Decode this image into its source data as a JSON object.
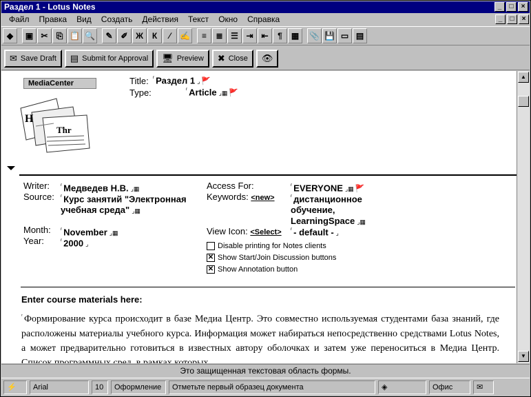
{
  "window": {
    "title": "Раздел 1 - Lotus Notes"
  },
  "menu": [
    "Файл",
    "Правка",
    "Вид",
    "Создать",
    "Действия",
    "Текст",
    "Окно",
    "Справка"
  ],
  "toolbar_icons": [
    "diamond-icon",
    "print-icon",
    "cut-icon",
    "copy-icon",
    "paste-icon",
    "preview-icon",
    "edit-icon",
    "pen-icon",
    "bold-icon",
    "italic-icon",
    "highlighter-icon",
    "paint-icon",
    "align-left-icon",
    "align-center-icon",
    "bullets-icon",
    "indent-icon",
    "outdent-icon",
    "paragraph-icon",
    "table-icon",
    "attach-icon",
    "save-icon",
    "panel-icon",
    "properties-icon"
  ],
  "toolbar_glyphs": [
    "◆",
    "▣",
    "✂",
    "⎘",
    "📋",
    "🔍",
    "✎",
    "✐",
    "Ж",
    "К",
    "⁄",
    "✍",
    "≡",
    "≣",
    "☰",
    "⇥",
    "⇤",
    "¶",
    "▦",
    "📎",
    "💾",
    "▭",
    "▤"
  ],
  "actions": [
    {
      "label": "Save Draft",
      "icon": "✉"
    },
    {
      "label": "Submit for Approval",
      "icon": "▤"
    },
    {
      "label": "Preview",
      "icon": "🖥"
    },
    {
      "label": "Close",
      "icon": "✖"
    },
    {
      "label": "",
      "icon": "👁"
    }
  ],
  "logo": {
    "label": "MediaCenter"
  },
  "header": {
    "title_label": "Title:",
    "title_value": "Раздел 1",
    "type_label": "Type:",
    "type_value": "Article"
  },
  "fields": {
    "writer_label": "Writer:",
    "writer_value": "Медведев Н.В.",
    "source_label": "Source:",
    "source_value": "Курс занятий \"Электронная учебная среда\"",
    "month_label": "Month:",
    "month_value": "November",
    "year_label": "Year:",
    "year_value": "2000",
    "access_label": "Access For:",
    "access_value": "EVERYONE",
    "keywords_label": "Keywords:",
    "keywords_link": "<new>",
    "keywords_value": "дистанционное обучение, LearningSpace",
    "viewicon_label": "View Icon:",
    "viewicon_link": "<Select>",
    "viewicon_value": "- default -"
  },
  "options": [
    {
      "label": "Disable printing for Notes clients",
      "checked": false
    },
    {
      "label": "Show Start/Join Discussion buttons",
      "checked": true
    },
    {
      "label": "Show Annotation button",
      "checked": true
    }
  ],
  "content": {
    "section_title": "Enter course materials here:",
    "body": "Формирование курса происходит в базе Медиа Центр. Это совместно используемая студентами база знаний, где расположены материалы учебного курса. Информация может набираться непосредственно средствами Lotus Notes, а может предварительно готовиться в известных автору оболочках и затем уже переноситься в Медиа Центр. Список программных сред, в рамках которых"
  },
  "status": {
    "message": "Это защищенная текстовая область формы.",
    "font": "Arial",
    "size": "10",
    "style": "Оформление",
    "info": "Отметьте первый образец документа",
    "location": "Офис"
  }
}
